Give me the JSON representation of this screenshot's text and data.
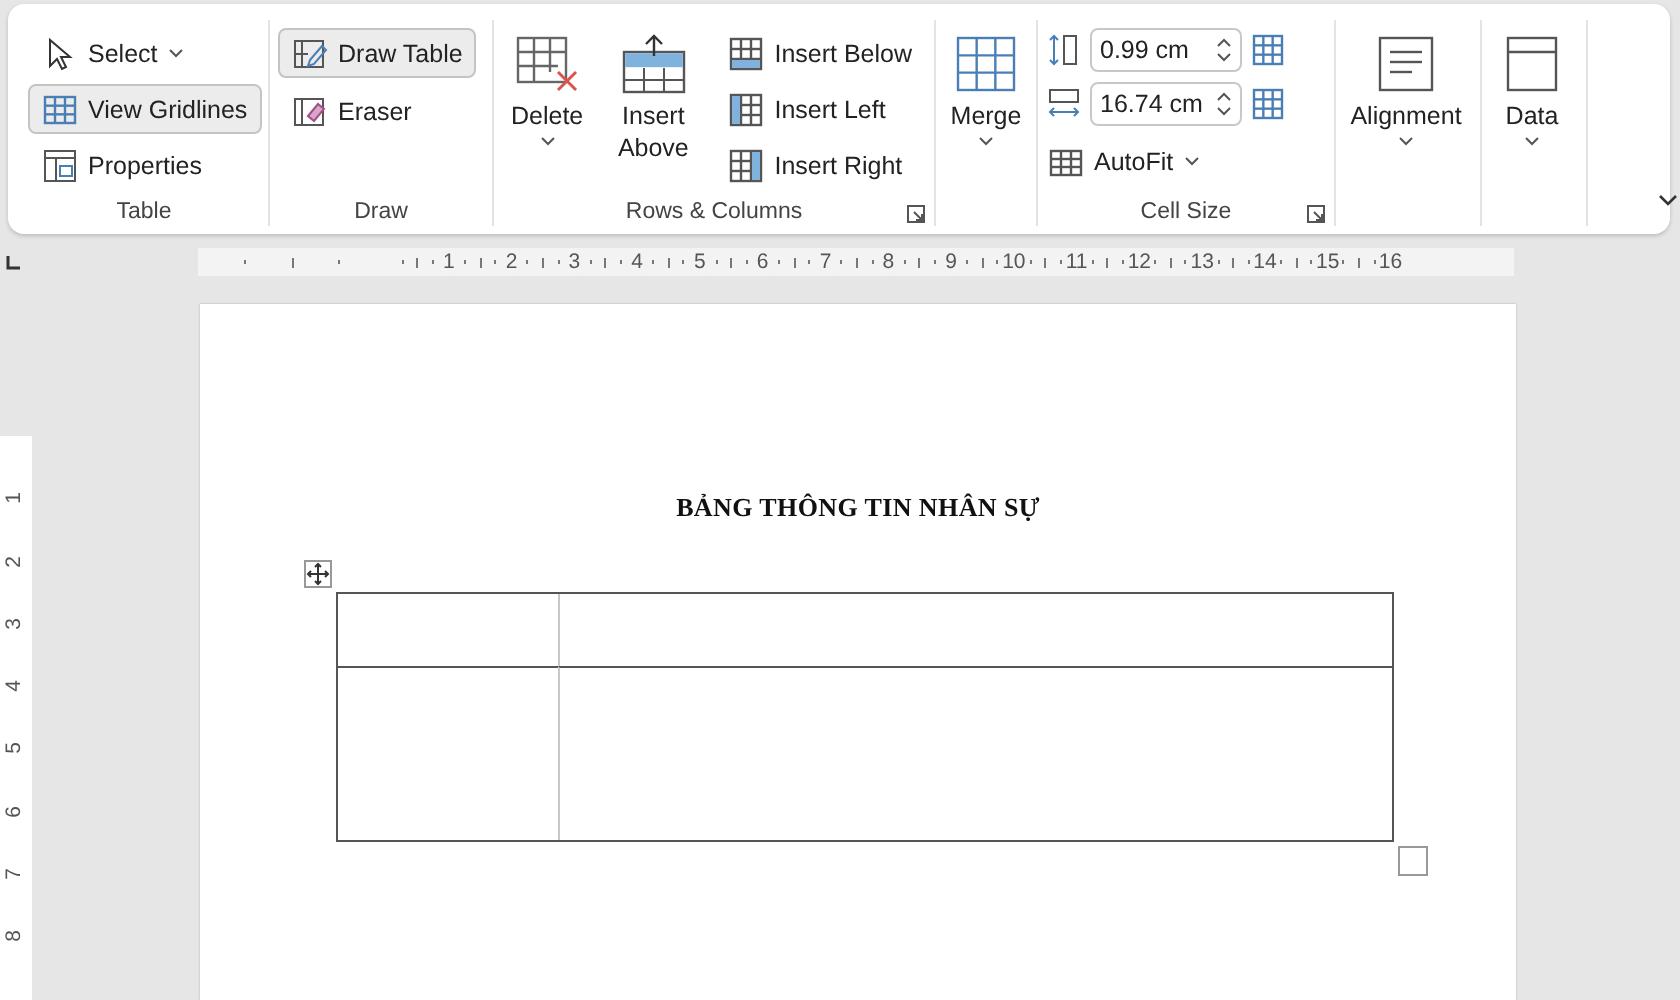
{
  "ribbon": {
    "table": {
      "label": "Table",
      "select": {
        "label": "Select"
      },
      "view_gridlines": {
        "label": "View Gridlines",
        "on": true
      },
      "properties": {
        "label": "Properties",
        "on": false
      }
    },
    "draw": {
      "label": "Draw",
      "draw_table": {
        "label": "Draw Table",
        "on": true
      },
      "eraser": {
        "label": "Eraser",
        "on": false
      }
    },
    "rows_columns": {
      "label": "Rows & Columns",
      "delete": "Delete",
      "insert_above": "Insert Above",
      "insert_below": "Insert Below",
      "insert_left": "Insert Left",
      "insert_right": "Insert Right"
    },
    "merge": {
      "label": "Merge"
    },
    "cell_size": {
      "label": "Cell Size",
      "height": "0.99 cm",
      "width": "16.74 cm",
      "autofit": "AutoFit"
    },
    "alignment": {
      "label": "Alignment"
    },
    "data": {
      "label": "Data"
    }
  },
  "ruler": {
    "horizontal": [
      "1",
      "2",
      "3",
      "4",
      "5",
      "6",
      "7",
      "8",
      "9",
      "10",
      "11",
      "12",
      "13",
      "14",
      "15",
      "16"
    ],
    "vertical": [
      "1",
      "2",
      "3",
      "4",
      "5",
      "6",
      "7",
      "8"
    ]
  },
  "document": {
    "title": "BẢNG THÔNG TIN NHÂN SỰ"
  }
}
